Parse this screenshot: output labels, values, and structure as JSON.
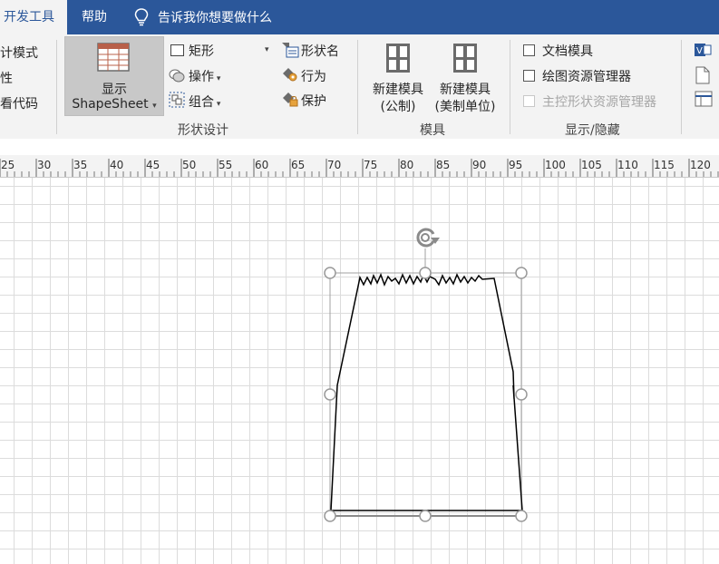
{
  "tabs": {
    "active": "开发工具",
    "help": "帮助",
    "tell_me": "告诉我你想要做什么"
  },
  "ribbon": {
    "left_group": {
      "item1": "计模式",
      "item2": "性",
      "item3": "看代码"
    },
    "shape_design": {
      "show_label_line1": "显示",
      "show_label_line2": "ShapeSheet",
      "rectangle": "矩形",
      "operation": "操作",
      "group": "组合",
      "shape_name": "形状名",
      "behavior": "行为",
      "protect": "保护",
      "group_label": "形状设计"
    },
    "stencil": {
      "new_metric_line1": "新建模具",
      "new_metric_line2": "(公制)",
      "new_us_line1": "新建模具",
      "new_us_line2": "(美制单位)",
      "group_label": "模具"
    },
    "show_hide": {
      "document_stencil": "文档模具",
      "drawing_explorer": "绘图资源管理器",
      "master_explorer": "主控形状资源管理器",
      "group_label": "显示/隐藏"
    }
  },
  "ruler": {
    "labels": [
      "25",
      "30",
      "35",
      "40",
      "45",
      "50",
      "55",
      "60",
      "65",
      "70",
      "75",
      "80",
      "85",
      "90",
      "95",
      "100",
      "105",
      "110",
      "115",
      "120"
    ]
  },
  "colors": {
    "tab_bar": "#2b579a",
    "ribbon_bg": "#f3f3f3",
    "grid": "#dcdcdc",
    "handle": "#999999"
  }
}
